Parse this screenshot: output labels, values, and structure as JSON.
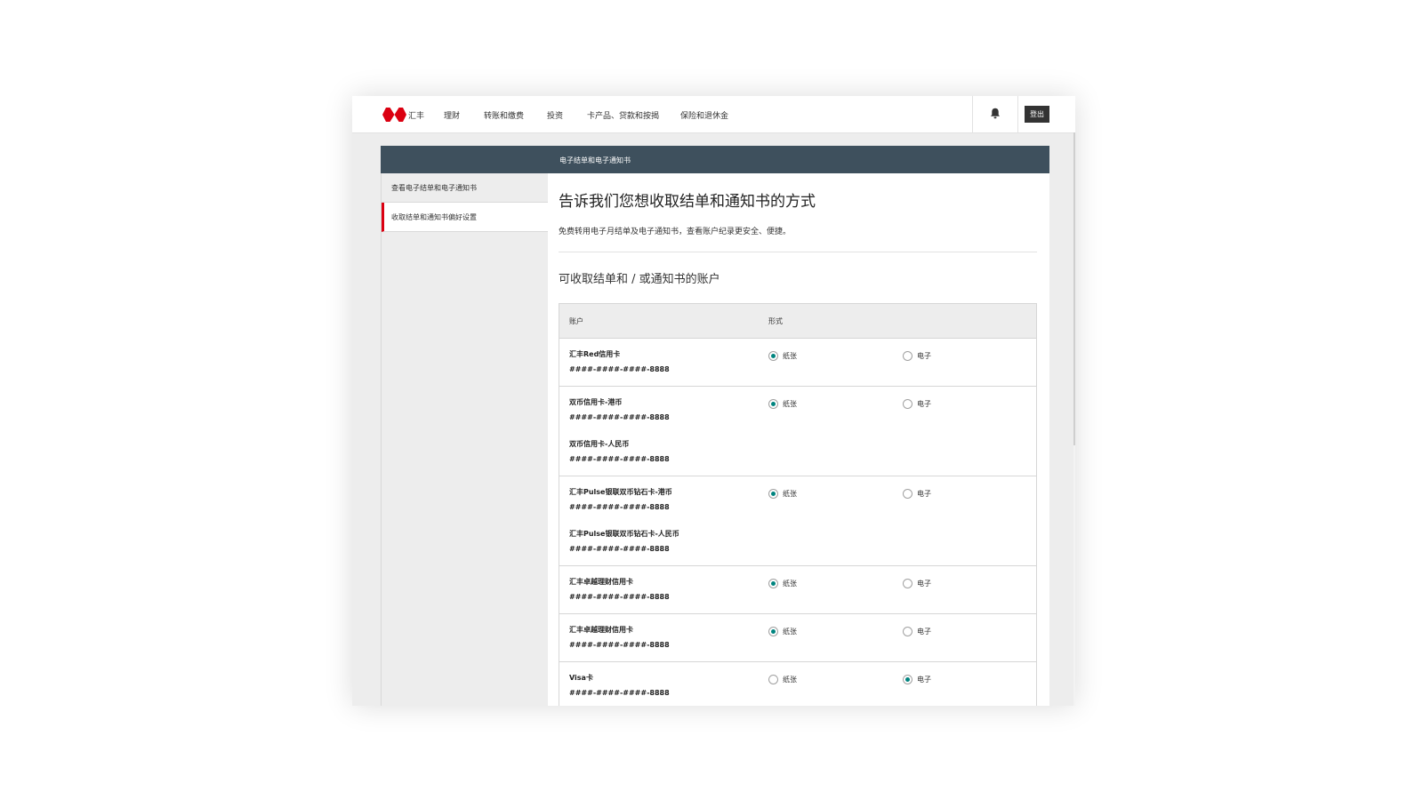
{
  "brand": {
    "name": "汇丰"
  },
  "nav": {
    "items": [
      "理财",
      "转账和缴费",
      "投资",
      "卡产品、贷款和按揭",
      "保险和退休金"
    ],
    "logout": "登出"
  },
  "banner": {
    "title": "电子结单和电子通知书"
  },
  "sidebar": {
    "items": [
      {
        "label": "查看电子结单和电子通知书",
        "active": false
      },
      {
        "label": "收取结单和通知书偏好设置",
        "active": true
      }
    ]
  },
  "content": {
    "heading": "告诉我们您想收取结单和通知书的方式",
    "intro": "免费转用电子月结单及电子通知书，查看账户纪录更安全、便捷。",
    "subheading": "可收取结单和 / 或通知书的账户",
    "table": {
      "headers": {
        "account": "账户",
        "format": "形式"
      },
      "option_labels": {
        "paper": "纸张",
        "electronic": "电子"
      },
      "rows": [
        {
          "accounts": [
            {
              "name": "汇丰Red信用卡",
              "number": "####-####-####-8888"
            }
          ],
          "selected": "paper"
        },
        {
          "accounts": [
            {
              "name": "双币信用卡-港币",
              "number": "####-####-####-8888"
            },
            {
              "name": "双币信用卡-人民币",
              "number": "####-####-####-8888"
            }
          ],
          "selected": "paper"
        },
        {
          "accounts": [
            {
              "name": "汇丰Pulse银联双币钻石卡-港币",
              "number": "####-####-####-8888"
            },
            {
              "name": "汇丰Pulse银联双币钻石卡-人民币",
              "number": "####-####-####-8888"
            }
          ],
          "selected": "paper"
        },
        {
          "accounts": [
            {
              "name": "汇丰卓越理财信用卡",
              "number": "####-####-####-8888"
            }
          ],
          "selected": "paper"
        },
        {
          "accounts": [
            {
              "name": "汇丰卓越理财信用卡",
              "number": "####-####-####-8888"
            }
          ],
          "selected": "paper"
        },
        {
          "accounts": [
            {
              "name": "Visa卡",
              "number": "####-####-####-8888"
            }
          ],
          "selected": "electronic"
        }
      ]
    }
  },
  "colors": {
    "accent_red": "#db0011",
    "banner": "#3e505d",
    "radio_selected": "#00847f"
  }
}
